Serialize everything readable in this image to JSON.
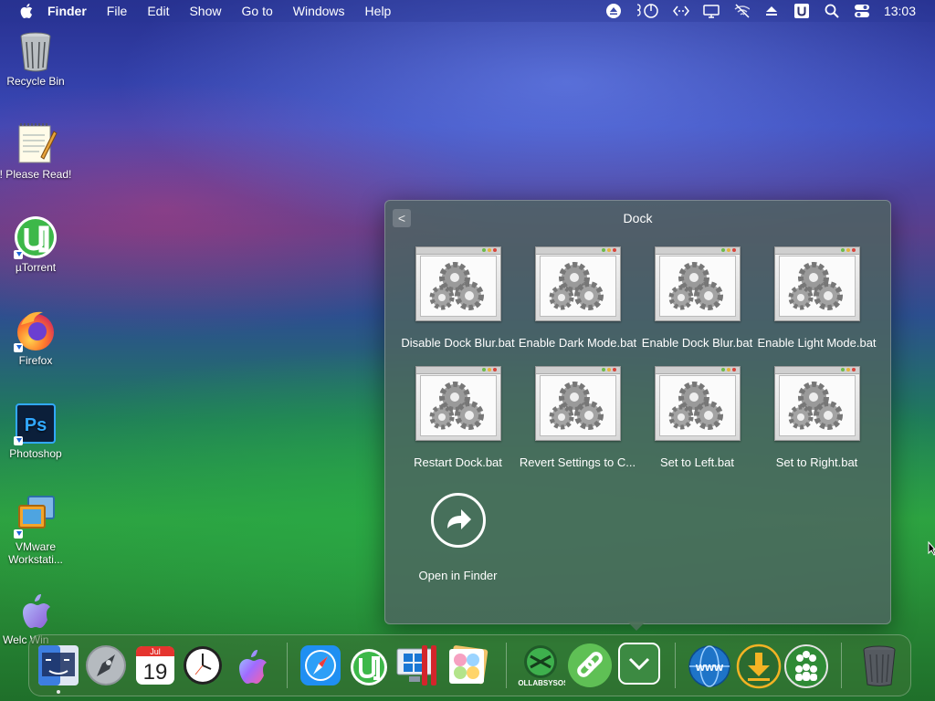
{
  "menubar": {
    "app_name": "Finder",
    "menus": [
      "File",
      "Edit",
      "Show",
      "Go to",
      "Windows",
      "Help"
    ],
    "clock": "13:03"
  },
  "status_icons": [
    "eject-icon",
    "power-icon",
    "code-arrows-icon",
    "display-icon",
    "wifi-off-icon",
    "eject-icon",
    "u-badge-icon",
    "search-icon",
    "control-center-icon"
  ],
  "desktop": {
    "icons": [
      {
        "label": "Recycle Bin",
        "icon": "recycle-bin-icon"
      },
      {
        "label": "! Please Read!",
        "icon": "notepad-icon"
      },
      {
        "label": "µTorrent",
        "icon": "utorrent-icon"
      },
      {
        "label": "Firefox",
        "icon": "firefox-icon"
      },
      {
        "label": "Photoshop",
        "icon": "photoshop-icon"
      },
      {
        "label": "VMware Workstati...",
        "icon": "vmware-icon"
      },
      {
        "label": "Welc Win",
        "icon": "apple-icon"
      }
    ]
  },
  "stack": {
    "title": "Dock",
    "back_label": "<",
    "items": [
      {
        "label": "Disable Dock Blur.bat"
      },
      {
        "label": "Enable Dark Mode.bat"
      },
      {
        "label": "Enable Dock Blur.bat"
      },
      {
        "label": "Enable Light Mode.bat"
      },
      {
        "label": "Restart Dock.bat"
      },
      {
        "label": "Revert Settings to C..."
      },
      {
        "label": "Set to Left.bat"
      },
      {
        "label": "Set to Right.bat"
      }
    ],
    "open_in_finder": "Open in Finder"
  },
  "dock": {
    "apps": [
      "finder-icon",
      "launchpad-icon",
      "calendar-icon",
      "clock-icon",
      "siri-icon",
      "safari-icon",
      "utorrent-icon",
      "windows-display-icon",
      "photos-icon",
      "collabsysos-icon",
      "link-icon",
      "stack-chevron-icon",
      "www-icon",
      "download-icon",
      "people-icon",
      "trash-icon"
    ],
    "calendar_month": "Jul",
    "calendar_day": "19",
    "collab_label": "COLLABSYSOS",
    "www_label": "www"
  },
  "colors": {
    "accent_green": "#3da34a",
    "stack_bg": "#4e6460"
  }
}
